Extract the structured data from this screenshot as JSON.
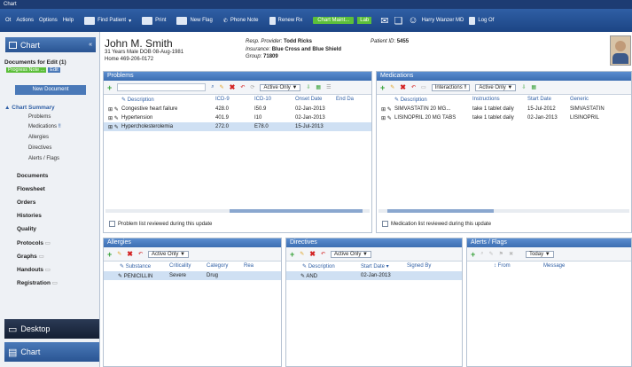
{
  "window": {
    "title": "Chart"
  },
  "menu": [
    "Ot",
    "Actions",
    "Options",
    "Help"
  ],
  "toolbar": {
    "find_patient": "Find Patient",
    "print": "Print",
    "new_flag": "New Flag",
    "phone_note": "Phone Note",
    "renew_rx": "Renew Rx",
    "chart_maint": "Chart Maint...",
    "lab": "Lab",
    "user": "Harry Wanzer MD",
    "logout": "Log Of"
  },
  "sidebar": {
    "chart_label": "Chart",
    "docs_for_edit": "Documents for Edit (1)",
    "doc_badge": "Progress Note ...",
    "doc_btn": "Edit",
    "new_document": "New Document",
    "chart_summary": "Chart Summary",
    "summary_items": [
      "Problems",
      "Medications",
      "Allergies",
      "Directives",
      "Alerts / Flags"
    ],
    "sections": [
      "Documents",
      "Flowsheet",
      "Orders",
      "Histories",
      "Quality",
      "Protocols",
      "Graphs",
      "Handouts",
      "Registration"
    ],
    "bottom_desktop": "Desktop",
    "bottom_chart": "Chart"
  },
  "patient": {
    "name": "John M. Smith",
    "line2": "31 Years  Male  DOB 08-Aug-1981",
    "line3": "Home 469-206-0172",
    "resp_provider_label": "Resp. Provider",
    "resp_provider": "Todd Ricks",
    "insurance_label": "Insurance",
    "insurance": "Blue Cross and Blue Shield",
    "group_label": "Group",
    "group": "71809",
    "patient_id_label": "Patient ID",
    "patient_id": "5455"
  },
  "problems": {
    "title": "Problems",
    "filter": "Active Only",
    "columns": [
      "Description",
      "ICD-9",
      "ICD-10",
      "Onset Date",
      "End Da"
    ],
    "rows": [
      [
        "Congestive heart failure",
        "428.0",
        "I50.9",
        "02-Jan-2013",
        ""
      ],
      [
        "Hypertension",
        "401.9",
        "I10",
        "02-Jan-2013",
        ""
      ],
      [
        "Hypercholesterolemia",
        "272.0",
        "E78.0",
        "15-Jul-2013",
        ""
      ]
    ],
    "footer": "Problem list reviewed during this update"
  },
  "medications": {
    "title": "Medications",
    "interactions": "Interactions",
    "filter": "Active Only",
    "columns": [
      "Description",
      "Instructions",
      "Start Date",
      "Generic"
    ],
    "rows": [
      [
        "SIMVASTATIN 20 MG...",
        "take 1 tablet daily",
        "15-Jul-2012",
        "SIMVASTATIN"
      ],
      [
        "LISINOPRIL 20 MG TABS",
        "take 1 tablet daily",
        "02-Jan-2013",
        "LISINOPRIL"
      ]
    ],
    "footer": "Medication list reviewed during this update"
  },
  "allergies": {
    "title": "Allergies",
    "filter": "Active Only",
    "columns": [
      "Substance",
      "Criticality",
      "Category",
      "Rea"
    ],
    "rows": [
      [
        "PENICILLIN",
        "Severe",
        "Drug",
        ""
      ]
    ]
  },
  "directives": {
    "title": "Directives",
    "filter": "Active Only",
    "columns": [
      "Description",
      "Start Date",
      "Signed By"
    ],
    "rows": [
      [
        "AND",
        "02-Jan-2013",
        ""
      ]
    ]
  },
  "alerts": {
    "title": "Alerts / Flags",
    "filter": "Today",
    "columns": [
      "From",
      "Message"
    ]
  },
  "colors": {
    "header_blue": "#3c6eb2",
    "title_bar": "#1d3c73",
    "green": "#5cbf3a",
    "selected_row": "#cfe0f3"
  }
}
